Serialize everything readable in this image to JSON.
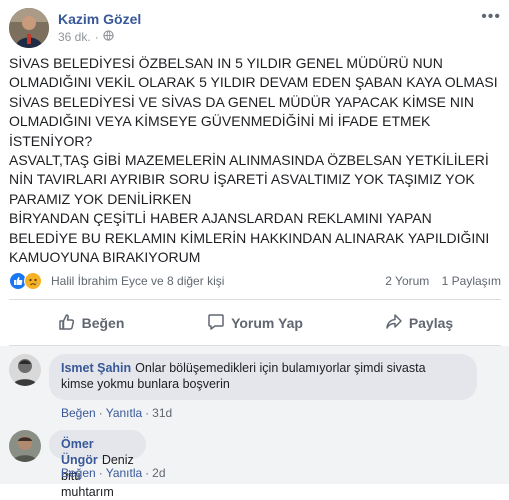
{
  "post": {
    "author": "Kazim Gözel",
    "time": "36 dk.",
    "text": "SİVAS BELEDİYESİ ÖZBELSAN IN 5 YILDIR GENEL MÜDÜRÜ NUN\nOLMADIĞINI VEKİL OLARAK 5 YILDIR DEVAM EDEN ŞABAN KAYA OLMASI\nSİVAS BELEDİYESİ VE SİVAS DA GENEL MÜDÜR YAPACAK KİMSE NIN\nOLMADIĞINI VEYA KİMSEYE GÜVENMEDİĞİNİ Mİ İFADE ETMEK\nİSTENİYOR?\nASVALT,TAŞ GİBİ MAZEMELERİN ALINMASINDA ÖZBELSAN YETKİLİLERİ\nNİN TAVIRLARI AYRIBIR SORU İŞARETİ ASVALTIMIZ YOK TAŞIMIZ YOK\nPARAMIZ YOK DENİLİRKEN\nBİRYANDAN ÇEŞİTLİ HABER AJANSLARDAN REKLAMINI YAPAN\nBELEDİYE BU REKLAMIN KİMLERİN HAKKINDAN ALINARAK YAPILDIĞINI\nKAMUOYUNA BIRAKIYORUM"
  },
  "reactions": {
    "names": "Halil İbrahim Eyce ve 8 diğer kişi",
    "comments_count": "2 Yorum",
    "shares_count": "1 Paylaşım"
  },
  "actions": {
    "like": "Beğen",
    "comment": "Yorum Yap",
    "share": "Paylaş"
  },
  "comments": [
    {
      "author": "Ismet Şahin",
      "text_line1": "Onlar bölüşemedikleri için bulamıyorlar şimdi sivasta",
      "text_line2": "kimse yokmu bunlara boşverin",
      "like": "Beğen",
      "reply": "Yanıtla",
      "time": "31d"
    },
    {
      "author": "Ömer Üngör",
      "text_line1": "Deniz bitti muhtarım",
      "like": "Beğen",
      "reply": "Yanıtla",
      "time": "2d"
    }
  ],
  "colors": {
    "link": "#385898",
    "like_blue": "#1877f2",
    "comment_bg": "#f2f3f5"
  }
}
